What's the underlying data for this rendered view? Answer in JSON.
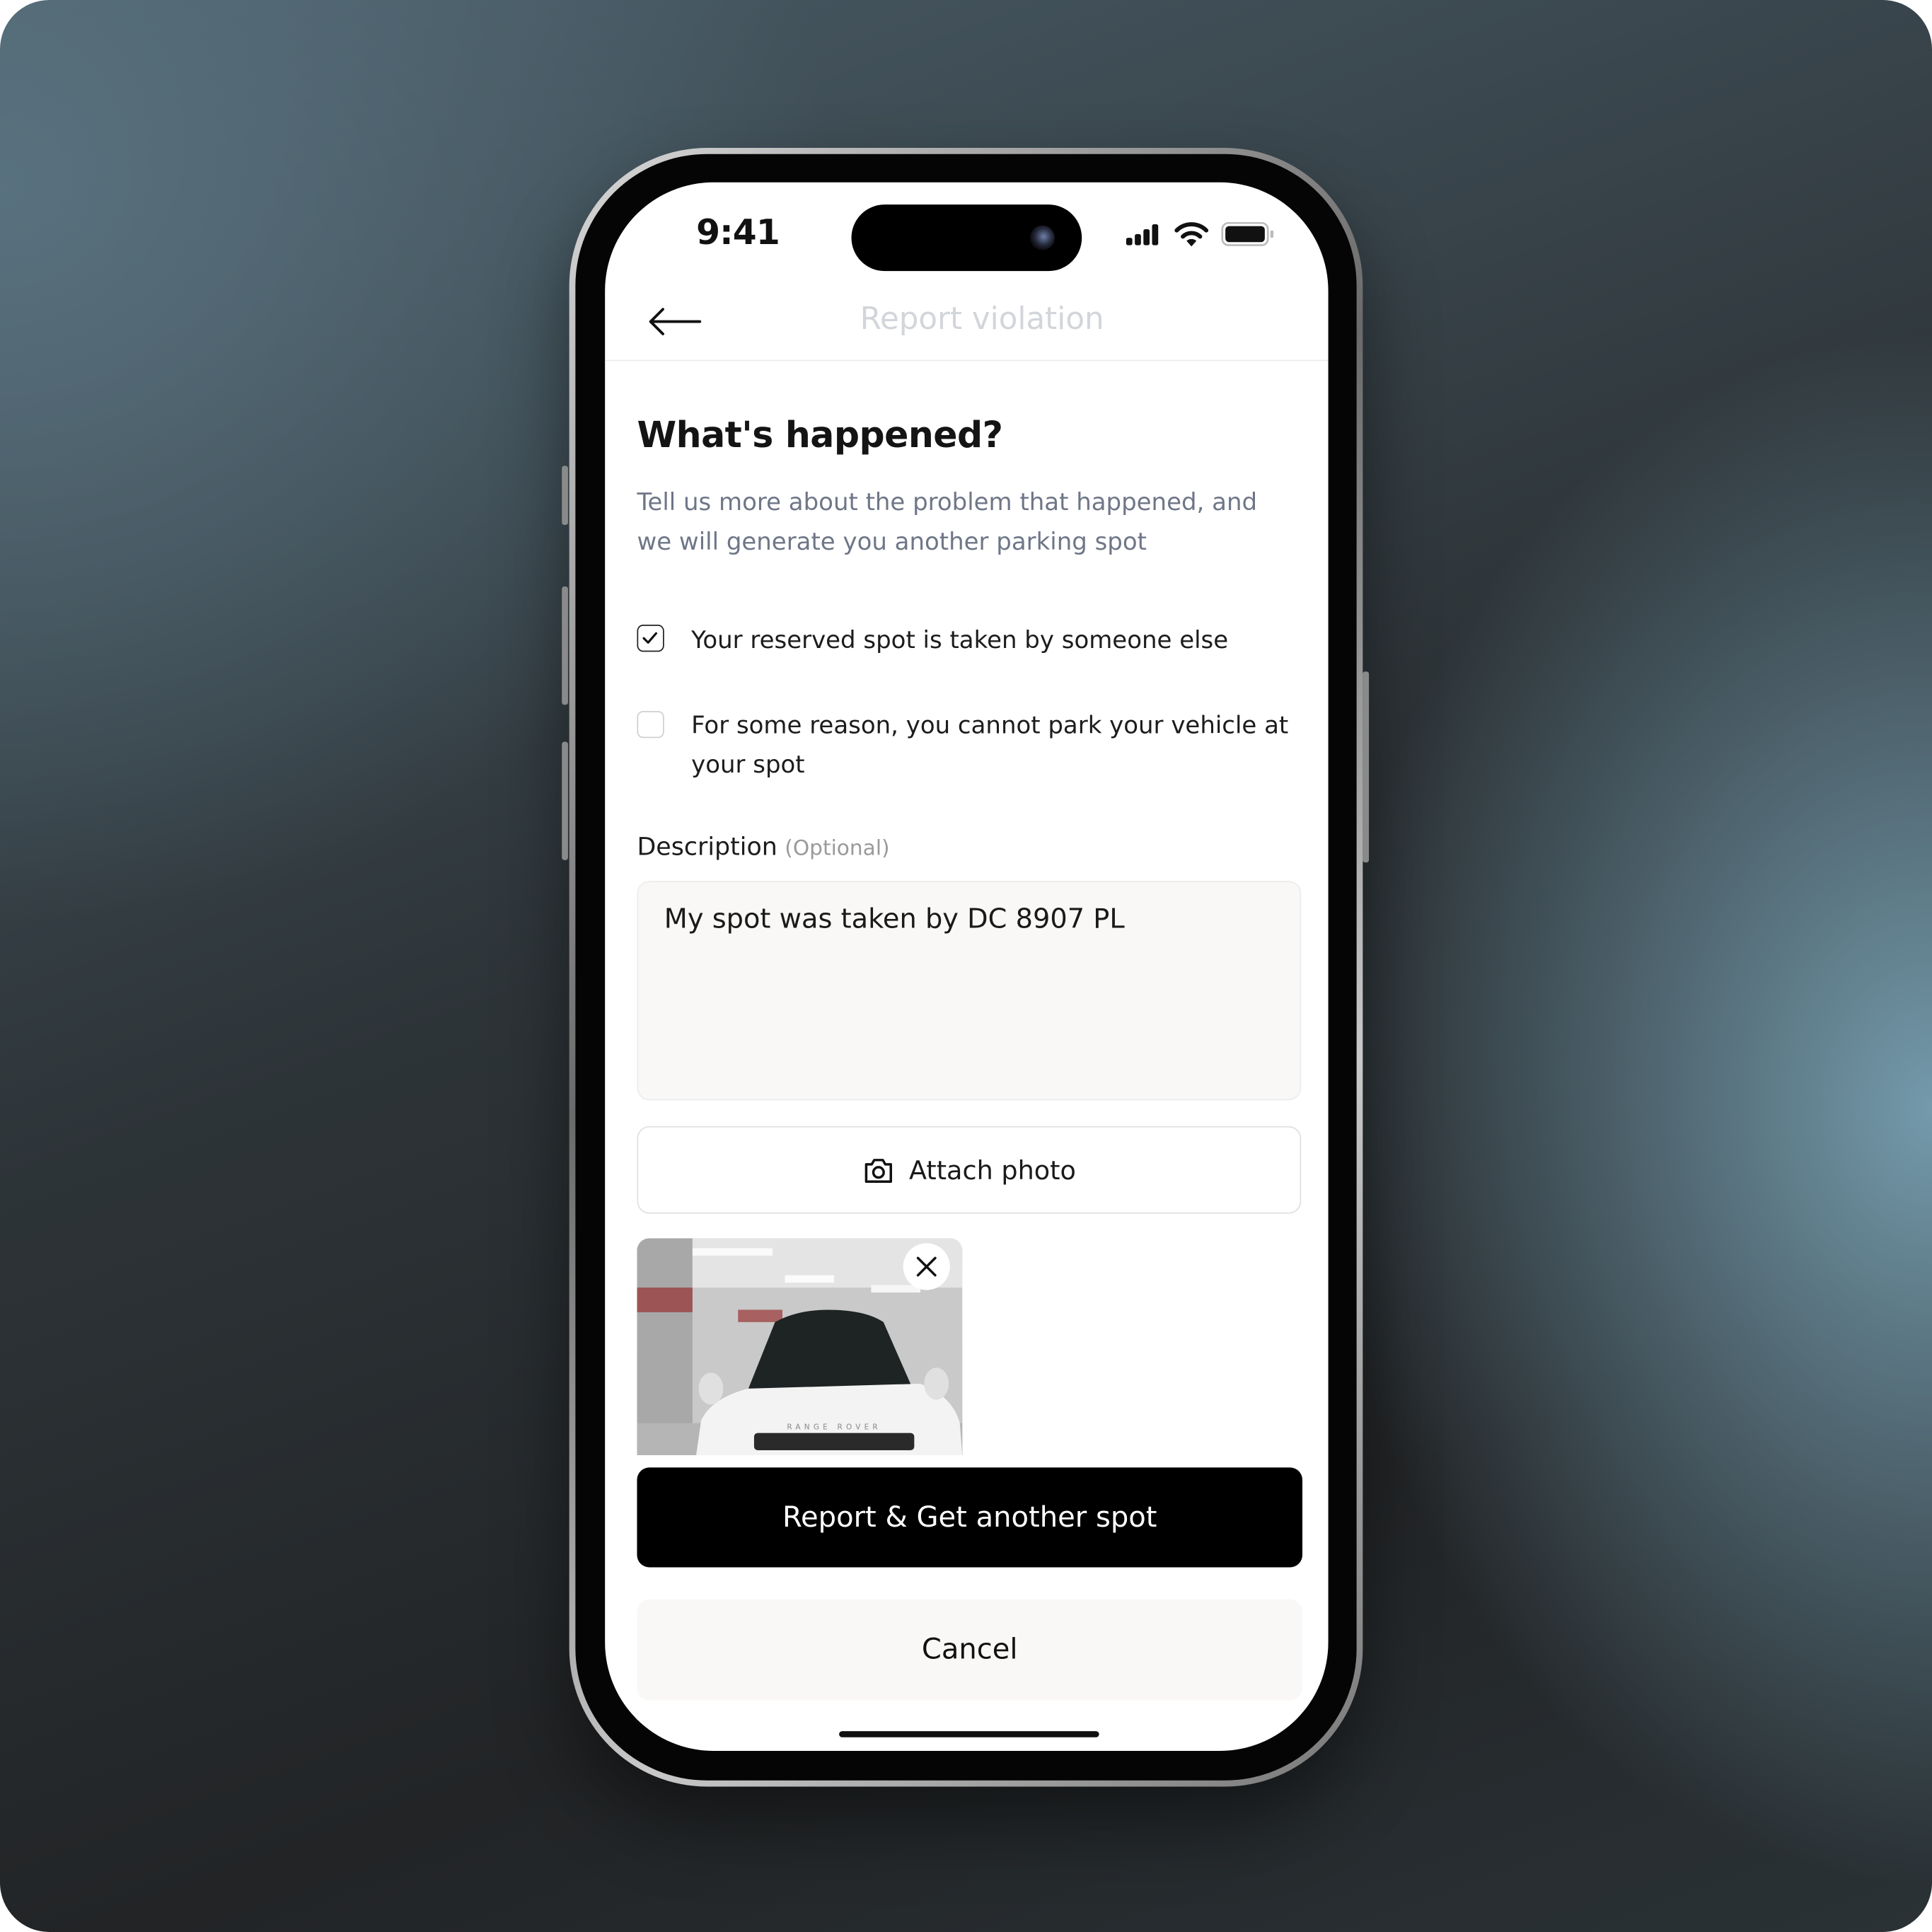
{
  "status_bar": {
    "time": "9:41",
    "icons": [
      "signal-icon",
      "wifi-icon",
      "battery-icon"
    ]
  },
  "header": {
    "title": "Report violation",
    "back_icon": "arrow-left-icon"
  },
  "content": {
    "heading": "What's happened?",
    "subtitle": "Tell us more about the problem that happened, and we will generate you another parking spot",
    "options": [
      {
        "label": "Your reserved spot is taken by someone else",
        "checked": true
      },
      {
        "label": "For some reason, you cannot park your vehicle at your spot",
        "checked": false
      }
    ],
    "description": {
      "label": "Description",
      "optional": "(Optional)",
      "value": "My spot was taken by DC 8907 PL"
    },
    "attach_label": "Attach photo",
    "photo": {
      "logo_text": "RANGE ROVER"
    },
    "primary_label": "Report & Get another spot",
    "cancel_label": "Cancel"
  },
  "colors": {
    "primary": "#000000",
    "muted_title": "#d2d5da",
    "subtitle": "#6e7687",
    "field_bg": "#f9f8f6"
  }
}
